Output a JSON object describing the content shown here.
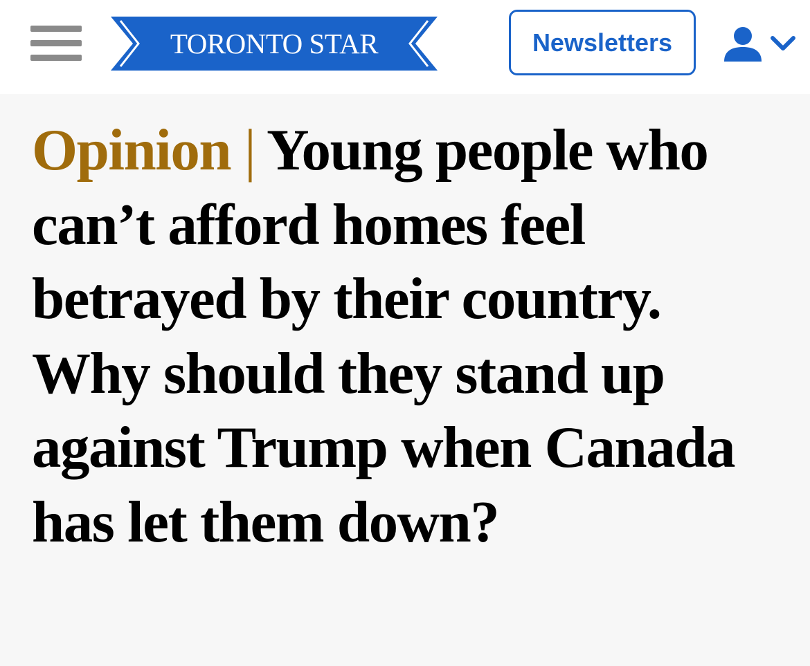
{
  "header": {
    "brand": "TORONTO STAR",
    "newsletters_label": "Newsletters",
    "icons": {
      "menu": "hamburger-menu-icon",
      "account": "user-icon",
      "account_toggle": "chevron-down-icon"
    }
  },
  "article": {
    "kicker": "Opinion",
    "separator": "|",
    "headline": "Young people who can’t afford homes feel betrayed by their country. Why should they stand up against Trump when Canada has let them down?"
  },
  "colors": {
    "brand_blue": "#1a63c9",
    "kicker_gold": "#a06c0c",
    "menu_gray": "#8a8a8a",
    "page_background": "#f7f7f7",
    "header_background": "#ffffff",
    "headline_text": "#000000"
  }
}
